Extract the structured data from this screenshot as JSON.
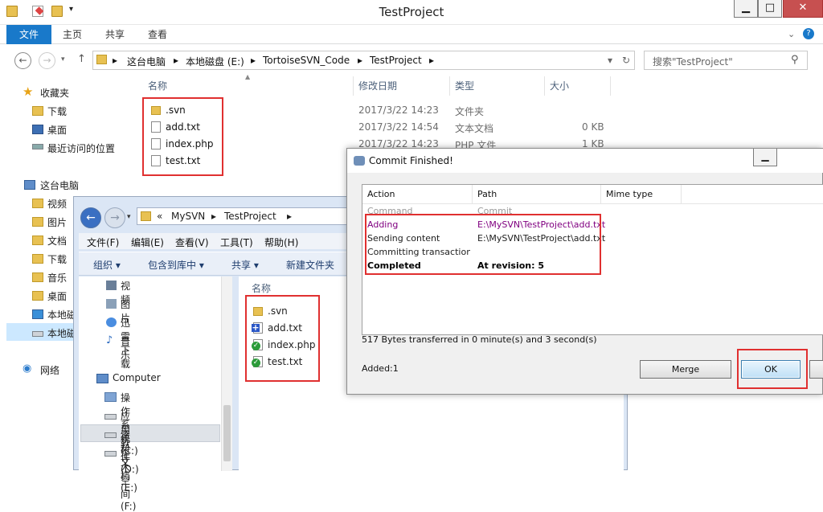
{
  "explorer_main": {
    "title": "TestProject",
    "ribbon_tabs": [
      "文件",
      "主页",
      "共享",
      "查看"
    ],
    "breadcrumb": [
      "这台电脑",
      "本地磁盘 (E:)",
      "TortoiseSVN_Code",
      "TestProject"
    ],
    "search_placeholder": "搜索\"TestProject\"",
    "columns": [
      "名称",
      "修改日期",
      "类型",
      "大小"
    ],
    "files": [
      {
        "name": ".svn",
        "date": "2017/3/22 14:23",
        "type": "文件夹",
        "size": ""
      },
      {
        "name": "add.txt",
        "date": "2017/3/22 14:54",
        "type": "文本文档",
        "size": "0 KB"
      },
      {
        "name": "index.php",
        "date": "2017/3/22 14:23",
        "type": "PHP 文件",
        "size": "1 KB"
      },
      {
        "name": "test.txt",
        "date": "",
        "type": "",
        "size": ""
      }
    ],
    "nav": [
      "收藏夹",
      "下载",
      "桌面",
      "最近访问的位置",
      "这台电脑",
      "视频",
      "图片",
      "文档",
      "下载",
      "音乐",
      "桌面",
      "本地磁",
      "本地磁",
      "网络"
    ]
  },
  "explorer_svn": {
    "breadcrumb": [
      "«",
      "MySVN",
      "TestProject"
    ],
    "menu": [
      "文件(F)",
      "编辑(E)",
      "查看(V)",
      "工具(T)",
      "帮助(H)"
    ],
    "toolbar": [
      "组织 ▾",
      "包含到库中 ▾",
      "共享 ▾",
      "新建文件夹"
    ],
    "nav": [
      "视频",
      "图片",
      "迅雷下载",
      "音乐",
      "Computer",
      "操作系统 (C:)",
      "应用软件 (D:)",
      "资料文档 (E:)",
      "个人空间 (F:)"
    ],
    "column_name": "名称",
    "files": [
      ".svn",
      "add.txt",
      "index.php",
      "test.txt"
    ]
  },
  "commit_dialog": {
    "title": "Commit Finished!",
    "columns": [
      "Action",
      "Path",
      "Mime type"
    ],
    "rows": [
      {
        "action": "Command",
        "path": "Commit"
      },
      {
        "action": "Adding",
        "path": "E:\\MySVN\\TestProject\\add.txt"
      },
      {
        "action": "Sending content",
        "path": "E:\\MySVN\\TestProject\\add.txt"
      },
      {
        "action": "Committing transaction...",
        "path": ""
      },
      {
        "action": "Completed",
        "path": "At revision: 5"
      }
    ],
    "transfer_info": "517 Bytes transferred in 0 minute(s) and 3 second(s)",
    "added": "Added:1",
    "merge_label": "Merge",
    "ok_label": "OK"
  },
  "colors": {
    "accent": "#1979ca",
    "highlight_box": "#e03030",
    "added_text": "#800080"
  }
}
